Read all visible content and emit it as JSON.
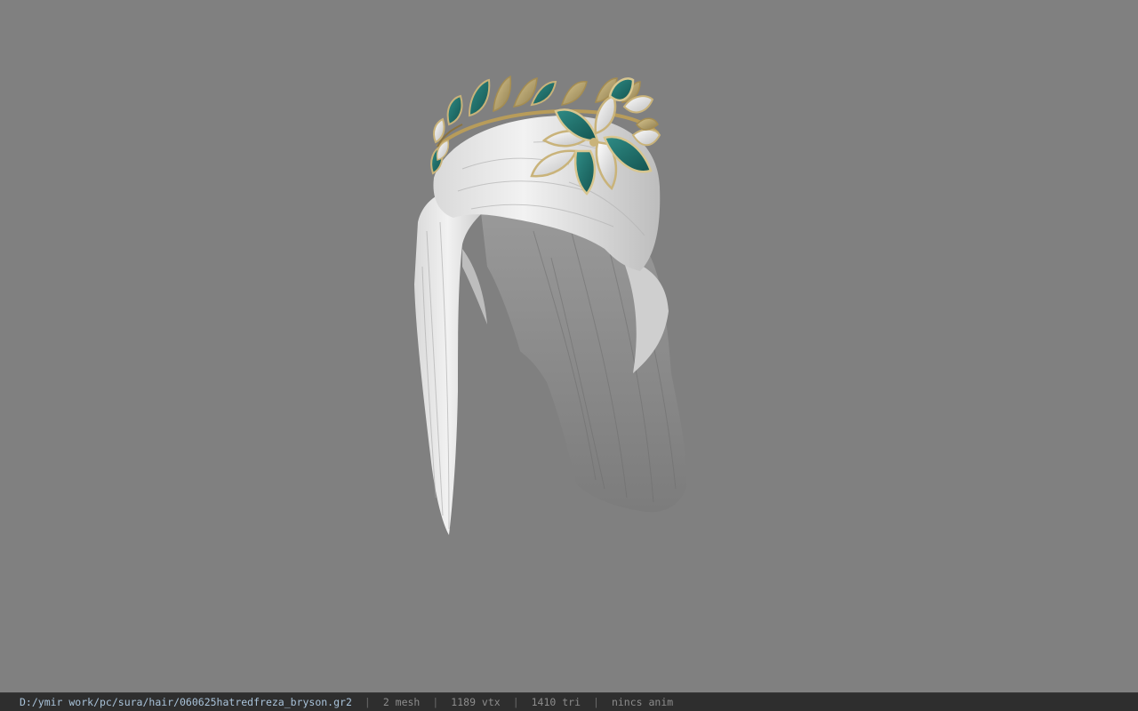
{
  "viewer": {
    "background_color": "#808080",
    "model_subject": "white hair with teal-and-gold leaf circlet"
  },
  "status_bar": {
    "file_path": "D:/ymir work/pc/sura/hair/060625hatredfreza_bryson.gr2",
    "mesh_count": "2 mesh",
    "vertex_count": "1189 vtx",
    "triangle_count": "1410 tri",
    "animation": "nincs anim",
    "separator": "|"
  },
  "colors": {
    "statusbar_bg": "#2e2e2e",
    "path_text": "#a9c3da",
    "stat_text": "#8c8c8c",
    "hair_light": "#e6e6e6",
    "hair_shadow": "#8a8a8a",
    "leaf_teal": "#1f6f6a",
    "leaf_white": "#e4e4e4",
    "leaf_gold": "#c9b37a"
  }
}
